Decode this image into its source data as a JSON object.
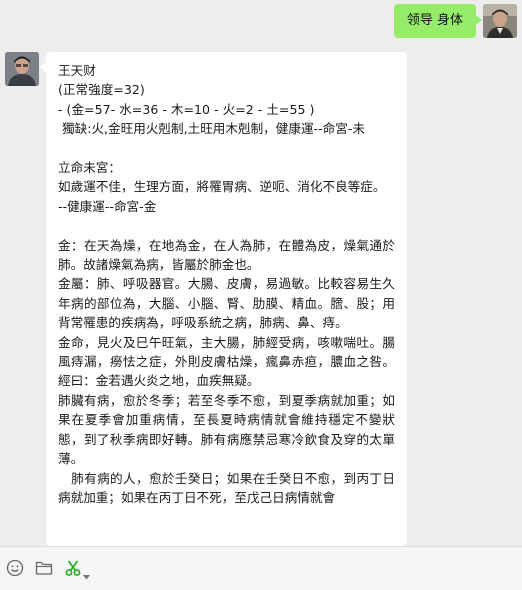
{
  "outgoing": {
    "text": "领导 身体"
  },
  "incoming": {
    "lines": [
      "王天财",
      "(正常強度=32)",
      "- (金=57- 水=36 - 木=10 - 火=2 - 土=55 )",
      " 獨缺:火,金旺用火剋制,土旺用木剋制，健康運--命宮-未",
      "",
      "立命未宮：",
      "如歲運不佳，生理方面，將罹胃病、逆呃、消化不良等症。",
      "--健康運--命宮-金",
      "",
      "金：在天為燥，在地為金，在人為肺，在體為皮，燥氣通於肺。故諸燥氣為病，皆屬於肺金也。",
      "金屬：肺、呼吸器官。大腸、皮膚，易過敏。比較容易生久年病的部位為，大腦、小腦、腎、肋膜、精血。膪、股；用背常罹患的疾病為，呼吸系統之病，肺病、鼻、痔。",
      "金命，見火及巳午旺氣，主大腸，肺經受病，咳嗽喘吐。腸風痔漏，癆怯之症，外則皮膚枯燥，瘋鼻赤疸，膿血之咎。經曰：金若遇火炎之地，血疾無疑。",
      "肺臟有病，愈於冬季；若至冬季不愈，到夏季病就加重；如果在夏季會加重病情，至長夏時病情就會維持穩定不變狀態，到了秋季病即好轉。肺有病應禁忌寒冷飲食及穿的太單薄。",
      "   肺有病的人，愈於壬癸日；如果在壬癸日不愈，到丙丁日病就加重；如果在丙丁日不死，至戊己日病情就會"
    ]
  },
  "toolbar": {
    "icons": [
      "smiley-icon",
      "folder-icon",
      "scissors-icon",
      "chevron-down-icon"
    ]
  },
  "colors": {
    "background": "#ededed",
    "outgoing_bubble": "#95ec69",
    "incoming_bubble": "#ffffff",
    "scissors": "#1aad19"
  }
}
